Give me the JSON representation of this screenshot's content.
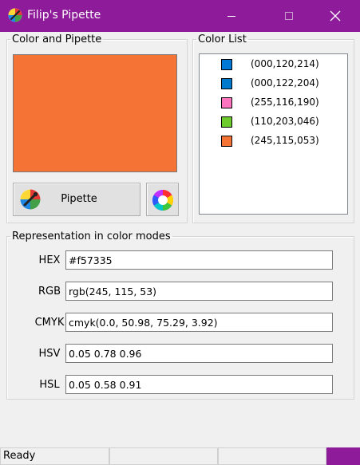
{
  "window": {
    "title": "Filip's Pipette",
    "minimize_icon": "minimize-icon",
    "maximize_icon": "maximize-icon",
    "close_icon": "close-icon"
  },
  "color_pipette": {
    "legend": "Color and Pipette",
    "current_color": "#f57335",
    "pipette_label": "Pipette",
    "pipette_icon": "pipette-icon",
    "wheel_icon": "color-wheel-icon"
  },
  "color_list": {
    "legend": "Color List",
    "items": [
      {
        "label": "(000,120,214)",
        "color": "#0078d6"
      },
      {
        "label": "(000,122,204)",
        "color": "#007acc"
      },
      {
        "label": "(255,116,190)",
        "color": "#ff74be"
      },
      {
        "label": "(110,203,046)",
        "color": "#6ecb2e"
      },
      {
        "label": "(245,115,053)",
        "color": "#f57335"
      }
    ]
  },
  "modes": {
    "legend": "Representation in color modes",
    "rows": [
      {
        "label": "HEX",
        "value": "#f57335"
      },
      {
        "label": "RGB",
        "value": "rgb(245, 115, 53)"
      },
      {
        "label": "CMYK",
        "value": "cmyk(0.0, 50.98, 75.29, 3.92)"
      },
      {
        "label": "HSV",
        "value": "0.05 0.78 0.96"
      },
      {
        "label": "HSL",
        "value": "0.05 0.58 0.91"
      }
    ]
  },
  "status": {
    "text": "Ready",
    "part2": "",
    "part3": "",
    "part4": ""
  },
  "colors": {
    "titlebar": "#8e1c9a",
    "window_bg": "#f0f0f0"
  }
}
